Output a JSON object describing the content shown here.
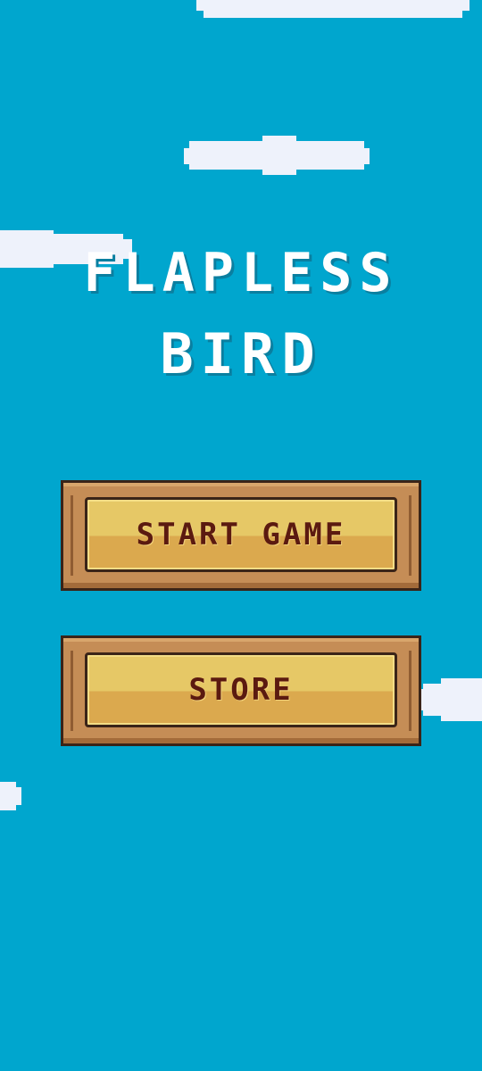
{
  "game": {
    "title_line1": "FLAPLESS",
    "title_line2": "BIRD"
  },
  "menu": {
    "start_label": "START GAME",
    "store_label": "STORE"
  },
  "colors": {
    "sky": "#00a6ce",
    "cloud": "#eef2fb",
    "title": "#ffffff",
    "wood": "#c58d56",
    "panel_top": "#e6c866",
    "panel_bottom": "#dba94e",
    "button_text": "#5b1a10"
  }
}
